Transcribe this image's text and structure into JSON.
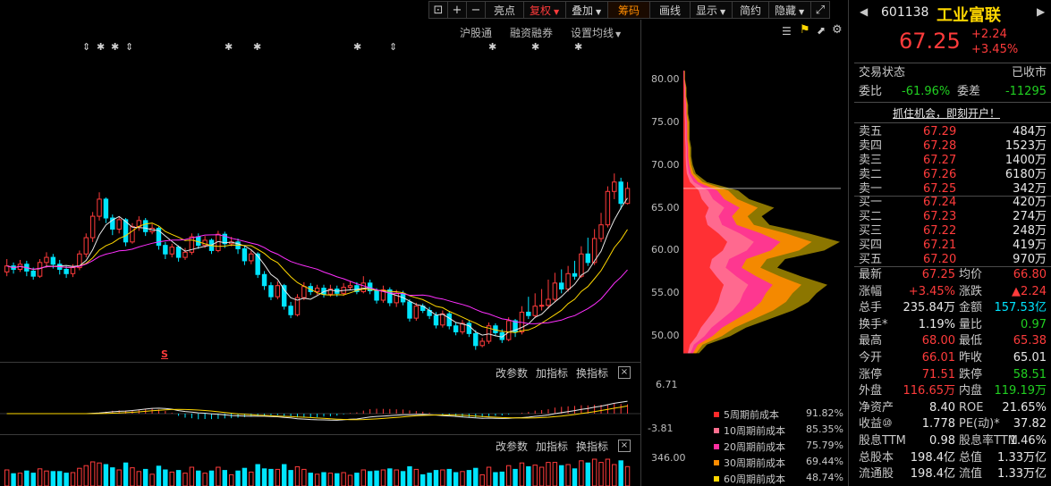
{
  "toolbar": {
    "lock_icon": "lock-icon",
    "zoom_in": "+",
    "zoom_out": "−",
    "highlight": "亮点",
    "adjust": "复权",
    "overlay": "叠加",
    "chip": "筹码",
    "draw": "画线",
    "display": "显示",
    "simple": "简约",
    "hide": "隐藏",
    "fullscreen_icon": "expand-icon"
  },
  "sublinks": {
    "hk_connect": "沪股通",
    "margin": "融资融券",
    "ma_settings": "设置均线"
  },
  "main_chart": {
    "y_ticks": [
      "80.00",
      "75.00",
      "70.00",
      "65.00",
      "60.00",
      "55.00",
      "50.00"
    ],
    "marker": "S"
  },
  "macd_panel": {
    "params": "改参数",
    "add_indicator": "加指标",
    "switch_indicator": "换指标",
    "close": "×",
    "y_ticks": [
      "6.71",
      "-3.81"
    ]
  },
  "vol_panel": {
    "params": "改参数",
    "add_indicator": "加指标",
    "switch_indicator": "换指标",
    "close": "×",
    "y_ticks": [
      "346.00"
    ]
  },
  "chip_legend": [
    {
      "label": "5周期前成本",
      "pct": "91.82%",
      "color": "#ff2a2a"
    },
    {
      "label": "10周期前成本",
      "pct": "85.35%",
      "color": "#ff6f8f"
    },
    {
      "label": "20周期前成本",
      "pct": "75.79%",
      "color": "#ff2fa0"
    },
    {
      "label": "30周期前成本",
      "pct": "69.44%",
      "color": "#ff8c00"
    },
    {
      "label": "60周期前成本",
      "pct": "48.74%",
      "color": "#ffd700"
    }
  ],
  "stock": {
    "code": "601138",
    "name": "工业富联",
    "price": "67.25",
    "change": "+2.24",
    "change_pct": "+3.45%"
  },
  "status": {
    "label": "交易状态",
    "value": "已收市"
  },
  "ratio": {
    "label1": "委比",
    "value1": "-61.96%",
    "label2": "委差",
    "value2": "-11295"
  },
  "promo": "抓住机会，即刻开户！",
  "asks": [
    {
      "label": "卖五",
      "price": "67.29",
      "vol": "484万"
    },
    {
      "label": "卖四",
      "price": "67.28",
      "vol": "1523万"
    },
    {
      "label": "卖三",
      "price": "67.27",
      "vol": "1400万"
    },
    {
      "label": "卖二",
      "price": "67.26",
      "vol": "6180万"
    },
    {
      "label": "卖一",
      "price": "67.25",
      "vol": "342万"
    }
  ],
  "bids": [
    {
      "label": "买一",
      "price": "67.24",
      "vol": "420万"
    },
    {
      "label": "买二",
      "price": "67.23",
      "vol": "274万"
    },
    {
      "label": "买三",
      "price": "67.22",
      "vol": "248万"
    },
    {
      "label": "买四",
      "price": "67.21",
      "vol": "419万"
    },
    {
      "label": "买五",
      "price": "67.20",
      "vol": "970万"
    }
  ],
  "quote": [
    {
      "l1": "最新",
      "v1": "67.25",
      "c1": "red",
      "l2": "均价",
      "v2": "66.80",
      "c2": "red"
    },
    {
      "l1": "涨幅",
      "v1": "+3.45%",
      "c1": "red",
      "l2": "涨跌",
      "v2": "▲2.24",
      "c2": "red"
    },
    {
      "l1": "总手",
      "v1": "235.84万",
      "c1": "white",
      "l2": "金额",
      "v2": "157.53亿",
      "c2": "cyan"
    },
    {
      "l1": "换手*",
      "v1": "1.19%",
      "c1": "white",
      "l2": "量比",
      "v2": "0.97",
      "c2": "green"
    },
    {
      "l1": "最高",
      "v1": "68.00",
      "c1": "red",
      "l2": "最低",
      "v2": "65.38",
      "c2": "red"
    },
    {
      "l1": "今开",
      "v1": "66.01",
      "c1": "red",
      "l2": "昨收",
      "v2": "65.01",
      "c2": "white"
    },
    {
      "l1": "涨停",
      "v1": "71.51",
      "c1": "red",
      "l2": "跌停",
      "v2": "58.51",
      "c2": "green"
    },
    {
      "l1": "外盘",
      "v1": "116.65万",
      "c1": "red",
      "l2": "内盘",
      "v2": "119.19万",
      "c2": "green"
    },
    {
      "l1": "净资产",
      "v1": "8.40",
      "c1": "white",
      "l2": "ROE",
      "v2": "21.65%",
      "c2": "white"
    },
    {
      "l1": "收益⑩",
      "v1": "1.778",
      "c1": "white",
      "l2": "PE(动)*",
      "v2": "37.82",
      "c2": "white"
    },
    {
      "l1": "股息TTM",
      "v1": "0.98",
      "c1": "white",
      "l2": "股息率TTM",
      "v2": "1.46%",
      "c2": "white"
    },
    {
      "l1": "总股本",
      "v1": "198.4亿",
      "c1": "white",
      "l2": "总值",
      "v2": "1.33万亿",
      "c2": "white"
    },
    {
      "l1": "流通股",
      "v1": "198.4亿",
      "c1": "white",
      "l2": "流值",
      "v2": "1.33万亿",
      "c2": "white"
    }
  ],
  "chart_data": {
    "type": "candlestick",
    "ylim": [
      47,
      83
    ],
    "ma_colors": {
      "ma5": "#e8e8e8",
      "ma10": "#ffd700",
      "ma20": "#ff2fff"
    },
    "candles": [
      [
        57.5,
        58.2,
        59.0,
        57.0
      ],
      [
        58.2,
        57.8,
        58.6,
        57.3
      ],
      [
        57.8,
        58.4,
        58.9,
        57.5
      ],
      [
        58.4,
        57.6,
        58.8,
        57.0
      ],
      [
        57.6,
        57.0,
        58.0,
        56.6
      ],
      [
        57.0,
        58.6,
        59.0,
        56.8
      ],
      [
        58.6,
        59.2,
        59.8,
        58.0
      ],
      [
        59.2,
        58.4,
        59.6,
        57.9
      ],
      [
        58.4,
        57.8,
        58.9,
        57.2
      ],
      [
        57.8,
        57.3,
        58.2,
        56.8
      ],
      [
        57.3,
        58.0,
        58.4,
        56.9
      ],
      [
        58.0,
        59.6,
        60.0,
        57.7
      ],
      [
        59.6,
        61.5,
        62.0,
        59.2
      ],
      [
        61.5,
        64.0,
        64.5,
        61.0
      ],
      [
        64.0,
        66.0,
        66.8,
        63.5
      ],
      [
        66.0,
        63.8,
        66.2,
        63.2
      ],
      [
        63.8,
        62.5,
        64.2,
        61.8
      ],
      [
        62.5,
        63.6,
        64.0,
        62.0
      ],
      [
        63.6,
        61.0,
        63.8,
        60.5
      ],
      [
        61.0,
        62.8,
        63.2,
        60.8
      ],
      [
        62.8,
        63.5,
        64.0,
        62.3
      ],
      [
        63.5,
        62.2,
        63.8,
        61.7
      ],
      [
        62.2,
        62.6,
        63.1,
        61.9
      ],
      [
        62.6,
        60.6,
        62.8,
        60.1
      ],
      [
        60.6,
        59.6,
        61.0,
        59.0
      ],
      [
        59.6,
        60.4,
        60.8,
        59.2
      ],
      [
        60.4,
        59.2,
        60.6,
        58.7
      ],
      [
        59.2,
        59.8,
        60.3,
        58.9
      ],
      [
        59.8,
        61.6,
        62.0,
        59.5
      ],
      [
        61.6,
        60.6,
        62.0,
        60.2
      ],
      [
        60.6,
        61.2,
        61.7,
        60.3
      ],
      [
        61.2,
        60.0,
        61.4,
        59.6
      ],
      [
        60.0,
        61.9,
        62.3,
        59.8
      ],
      [
        61.9,
        60.8,
        62.2,
        60.3
      ],
      [
        60.8,
        61.0,
        61.6,
        60.5
      ],
      [
        61.0,
        60.2,
        61.4,
        59.6
      ],
      [
        60.2,
        58.8,
        60.6,
        58.3
      ],
      [
        58.8,
        59.6,
        60.0,
        58.4
      ],
      [
        59.6,
        57.2,
        59.8,
        56.8
      ],
      [
        57.2,
        55.9,
        57.6,
        55.4
      ],
      [
        55.9,
        54.6,
        56.3,
        54.2
      ],
      [
        54.6,
        55.9,
        56.4,
        54.3
      ],
      [
        55.9,
        53.5,
        56.1,
        53.1
      ],
      [
        53.5,
        52.5,
        54.0,
        52.1
      ],
      [
        52.5,
        54.5,
        54.9,
        52.3
      ],
      [
        54.5,
        55.8,
        56.3,
        54.2
      ],
      [
        55.8,
        55.2,
        56.2,
        54.8
      ],
      [
        55.2,
        55.6,
        56.0,
        54.8
      ],
      [
        55.6,
        54.9,
        56.0,
        54.5
      ],
      [
        54.9,
        55.5,
        56.0,
        54.6
      ],
      [
        55.5,
        55.0,
        55.9,
        54.6
      ],
      [
        55.0,
        55.7,
        56.2,
        54.7
      ],
      [
        55.7,
        55.9,
        56.4,
        55.4
      ],
      [
        55.9,
        55.2,
        56.3,
        54.9
      ],
      [
        55.2,
        56.2,
        57.0,
        55.0
      ],
      [
        56.2,
        55.3,
        56.6,
        54.9
      ],
      [
        55.3,
        54.2,
        55.6,
        53.8
      ],
      [
        54.2,
        55.4,
        55.9,
        53.9
      ],
      [
        55.4,
        53.9,
        55.7,
        53.5
      ],
      [
        53.9,
        55.0,
        55.4,
        53.4
      ],
      [
        55.0,
        54.0,
        55.3,
        53.6
      ],
      [
        54.0,
        52.1,
        54.3,
        51.7
      ],
      [
        52.1,
        53.5,
        53.9,
        51.8
      ],
      [
        53.5,
        53.0,
        53.8,
        52.7
      ],
      [
        53.0,
        52.4,
        53.4,
        52.0
      ],
      [
        52.4,
        51.3,
        52.8,
        50.9
      ],
      [
        51.3,
        52.6,
        53.0,
        51.0
      ],
      [
        52.6,
        51.2,
        52.9,
        50.8
      ],
      [
        51.2,
        50.5,
        51.6,
        50.1
      ],
      [
        50.5,
        51.5,
        51.9,
        50.2
      ],
      [
        51.5,
        50.3,
        51.8,
        49.9
      ],
      [
        50.3,
        48.9,
        50.7,
        48.4
      ],
      [
        48.9,
        49.4,
        49.8,
        48.7
      ],
      [
        49.4,
        51.2,
        51.6,
        49.1
      ],
      [
        51.2,
        50.4,
        51.5,
        50.0
      ],
      [
        50.4,
        49.6,
        50.8,
        49.2
      ],
      [
        49.6,
        51.8,
        52.2,
        49.4
      ],
      [
        51.8,
        50.5,
        52.0,
        49.9
      ],
      [
        50.5,
        52.8,
        53.5,
        50.2
      ],
      [
        52.8,
        52.4,
        54.6,
        52.0
      ],
      [
        52.4,
        53.5,
        55.0,
        52.1
      ],
      [
        53.5,
        53.6,
        55.5,
        53.0
      ],
      [
        53.6,
        54.3,
        56.6,
        53.2
      ],
      [
        54.3,
        56.2,
        57.4,
        54.0
      ],
      [
        56.2,
        55.5,
        57.8,
        55.0
      ],
      [
        55.5,
        57.3,
        58.2,
        55.2
      ],
      [
        57.3,
        57.0,
        58.8,
        56.6
      ],
      [
        57.0,
        59.6,
        60.5,
        56.8
      ],
      [
        59.6,
        58.6,
        61.5,
        58.2
      ],
      [
        58.6,
        61.4,
        62.5,
        58.3
      ],
      [
        61.4,
        63.0,
        64.4,
        61.0
      ],
      [
        63.0,
        66.9,
        67.5,
        62.7
      ],
      [
        66.9,
        68.0,
        69.0,
        66.0
      ],
      [
        68.0,
        65.5,
        68.5,
        64.8
      ],
      [
        65.5,
        67.25,
        68.0,
        65.38
      ]
    ],
    "chip_distribution": {
      "price_range": [
        48,
        81
      ],
      "profile": [
        [
          48,
          0.1
        ],
        [
          49,
          0.15
        ],
        [
          50,
          0.3
        ],
        [
          51,
          0.4
        ],
        [
          52,
          0.55
        ],
        [
          53,
          0.7
        ],
        [
          54,
          0.8
        ],
        [
          55,
          0.85
        ],
        [
          56,
          0.92
        ],
        [
          57,
          0.75
        ],
        [
          58,
          0.6
        ],
        [
          59,
          0.65
        ],
        [
          60,
          0.9
        ],
        [
          61,
          1.0
        ],
        [
          62,
          0.8
        ],
        [
          63,
          0.55
        ],
        [
          64,
          0.5
        ],
        [
          65,
          0.58
        ],
        [
          66,
          0.42
        ],
        [
          67,
          0.35
        ],
        [
          68,
          0.15
        ],
        [
          69,
          0.08
        ],
        [
          70,
          0.06
        ],
        [
          71,
          0.05
        ],
        [
          72,
          0.05
        ],
        [
          73,
          0.04
        ],
        [
          74,
          0.04
        ],
        [
          75,
          0.04
        ],
        [
          76,
          0.03
        ],
        [
          77,
          0.03
        ],
        [
          78,
          0.02
        ],
        [
          79,
          0.02
        ],
        [
          80,
          0.01
        ],
        [
          81,
          0.01
        ]
      ]
    }
  }
}
